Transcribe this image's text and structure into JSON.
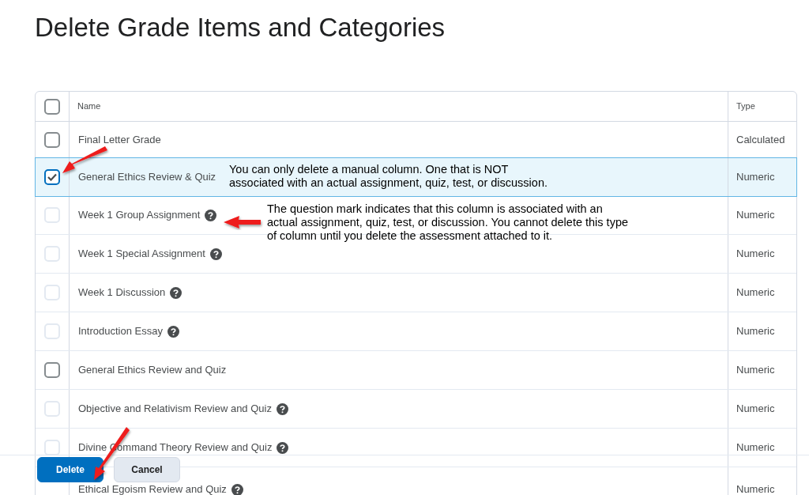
{
  "title": "Delete Grade Items and Categories",
  "table": {
    "columns": [
      "Name",
      "Type"
    ],
    "select_all": {
      "checked": false
    },
    "rows": [
      {
        "name": "Final Letter Grade",
        "type": "Calculated",
        "checked": false,
        "selected": false,
        "disabled": false,
        "help": false
      },
      {
        "name": "General Ethics Review & Quiz",
        "type": "Numeric",
        "checked": true,
        "selected": true,
        "disabled": false,
        "help": false
      },
      {
        "name": "Week 1 Group Assignment",
        "type": "Numeric",
        "checked": false,
        "selected": false,
        "disabled": true,
        "help": true
      },
      {
        "name": "Week 1 Special Assignment",
        "type": "Numeric",
        "checked": false,
        "selected": false,
        "disabled": true,
        "help": true
      },
      {
        "name": "Week 1 Discussion",
        "type": "Numeric",
        "checked": false,
        "selected": false,
        "disabled": true,
        "help": true
      },
      {
        "name": "Introduction Essay",
        "type": "Numeric",
        "checked": false,
        "selected": false,
        "disabled": true,
        "help": true
      },
      {
        "name": "General Ethics Review and Quiz",
        "type": "Numeric",
        "checked": false,
        "selected": false,
        "disabled": false,
        "help": false
      },
      {
        "name": "Objective and Relativism Review and Quiz",
        "type": "Numeric",
        "checked": false,
        "selected": false,
        "disabled": true,
        "help": true
      },
      {
        "name": "Divine Command Theory Review and Quiz",
        "type": "Numeric",
        "checked": false,
        "selected": false,
        "disabled": true,
        "help": true
      },
      {
        "name": "Ethical Egoism Review and Quiz",
        "type": "Numeric",
        "selected": false,
        "help": true
      }
    ]
  },
  "buttons": [
    {
      "label": "Delete",
      "kind": "primary"
    },
    {
      "label": "Cancel",
      "kind": "secondary"
    }
  ],
  "annotations": [
    {
      "lines": [
        "You can only delete a manual column. One that is NOT",
        "associated with an actual assignment, quiz, test, or discussion."
      ]
    },
    {
      "lines": [
        "The question mark indicates that this column is associated with an",
        "actual assignment, quiz, test, or discussion. You cannot delete this type",
        "of column until you delete the assessment attached to it."
      ]
    }
  ]
}
